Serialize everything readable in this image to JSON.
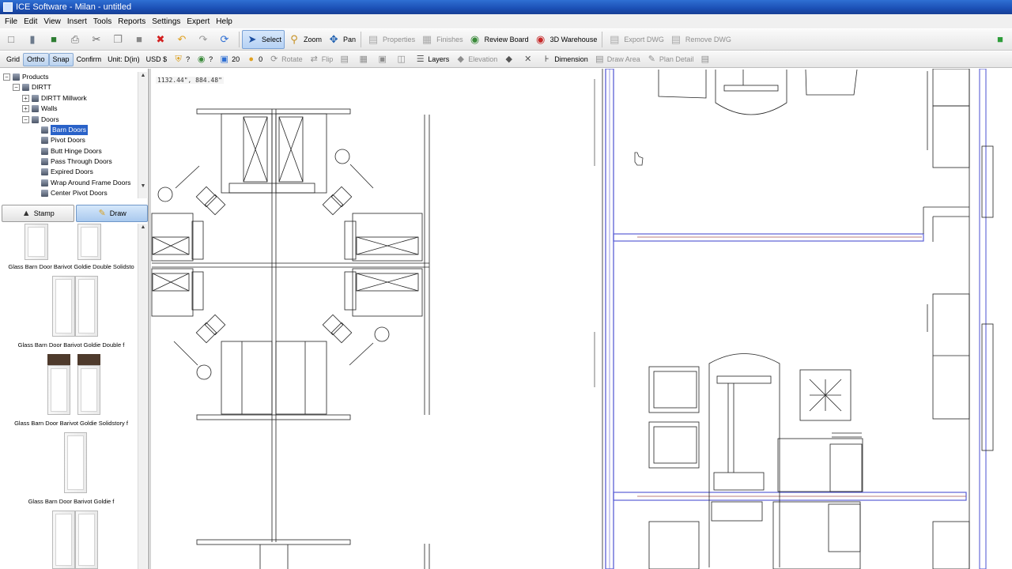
{
  "window": {
    "title": "ICE Software - Milan - untitled"
  },
  "menu": [
    "File",
    "Edit",
    "View",
    "Insert",
    "Tools",
    "Reports",
    "Settings",
    "Expert",
    "Help"
  ],
  "toolbar": {
    "select": "Select",
    "zoom": "Zoom",
    "pan": "Pan",
    "properties": "Properties",
    "finishes": "Finishes",
    "review_board": "Review Board",
    "warehouse": "3D Warehouse",
    "export_dwg": "Export DWG",
    "remove_dwg": "Remove DWG"
  },
  "toolbar2": {
    "grid": "Grid",
    "ortho": "Ortho",
    "snap": "Snap",
    "confirm": "Confirm",
    "unit": "Unit: D(in)",
    "currency": "USD $",
    "badge1": "?",
    "badge2": "?",
    "count1": "20",
    "count2": "0",
    "rotate": "Rotate",
    "flip": "Flip",
    "layers": "Layers",
    "elevation": "Elevation",
    "dimension": "Dimension",
    "draw_area": "Draw Area",
    "plan_detail": "Plan Detail"
  },
  "tree": {
    "items": [
      "Products",
      "DIRTT",
      "DIRTT Millwork",
      "Walls",
      "Doors",
      "Barn Doors",
      "Pivot Doors",
      "Butt Hinge Doors",
      "Pass Through Doors",
      "Expired Doors",
      "Wrap Around Frame Doors",
      "Center Pivot Doors"
    ],
    "selected": "Barn Doors"
  },
  "mode_tabs": {
    "stamp": "Stamp",
    "draw": "Draw"
  },
  "gallery": {
    "items": [
      "Glass Barn Door Barivot Goldie Double Solidsto",
      "Glass Barn Door Barivot Goldie Double f",
      "Glass Barn Door Barivot Goldie Solidstory f",
      "Glass Barn Door Barivot Goldie f"
    ]
  },
  "canvas": {
    "coordinates": "1132.44\", 884.48\""
  },
  "colors": {
    "wall_blue": "#5a5fd6",
    "wall_red": "#a05050",
    "title_blue": "#1b4fb5"
  }
}
